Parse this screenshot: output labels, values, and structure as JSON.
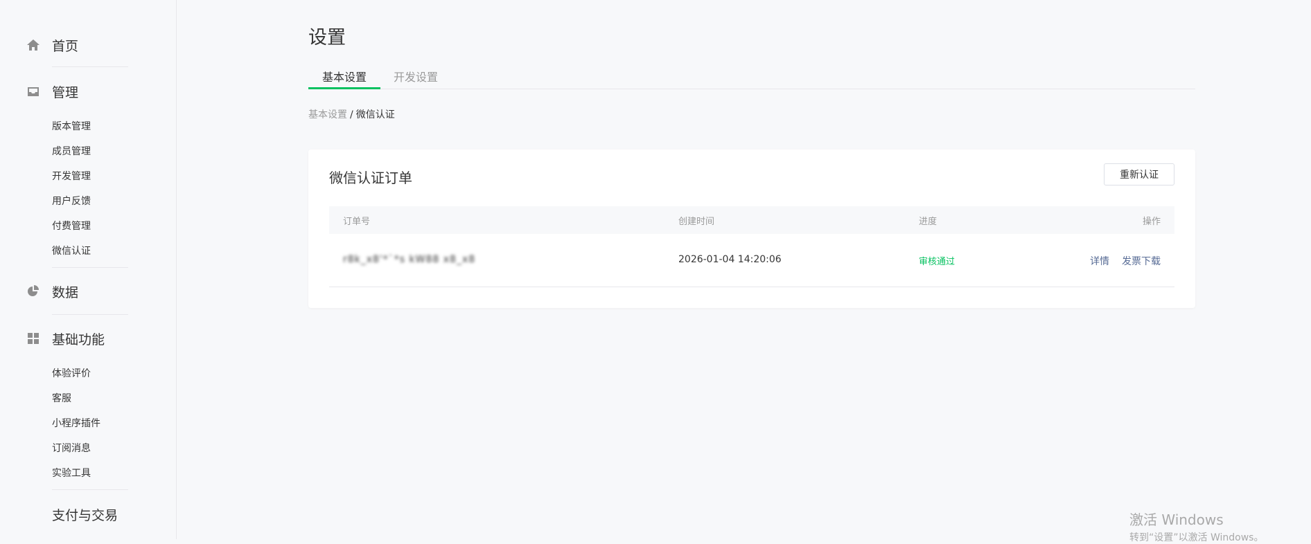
{
  "sidebar": {
    "home": "首页",
    "manage": {
      "label": "管理",
      "items": [
        "版本管理",
        "成员管理",
        "开发管理",
        "用户反馈",
        "付费管理",
        "微信认证"
      ]
    },
    "data": "数据",
    "basic": {
      "label": "基础功能",
      "items": [
        "体验评价",
        "客服",
        "小程序插件",
        "订阅消息",
        "实验工具"
      ]
    },
    "pay": "支付与交易"
  },
  "page": {
    "title": "设置",
    "tabs": [
      "基本设置",
      "开发设置"
    ],
    "breadcrumb": {
      "parent": "基本设置",
      "separator": "/",
      "current": "微信认证"
    }
  },
  "card": {
    "title": "微信认证订单",
    "reauth_button": "重新认证",
    "table": {
      "headers": [
        "订单号",
        "创建时间",
        "进度",
        "操作"
      ],
      "row": {
        "order_no": "r8k_x8'*`*s kW88 x8_x8",
        "created": "2026-01-04 14:20:06",
        "status": "审核通过",
        "actions": [
          "详情",
          "发票下载"
        ]
      }
    }
  },
  "watermark": {
    "line1": "激活 Windows",
    "line2": "转到“设置”以激活 Windows。"
  },
  "colors": {
    "accent": "#07c160",
    "link": "#576b95"
  }
}
